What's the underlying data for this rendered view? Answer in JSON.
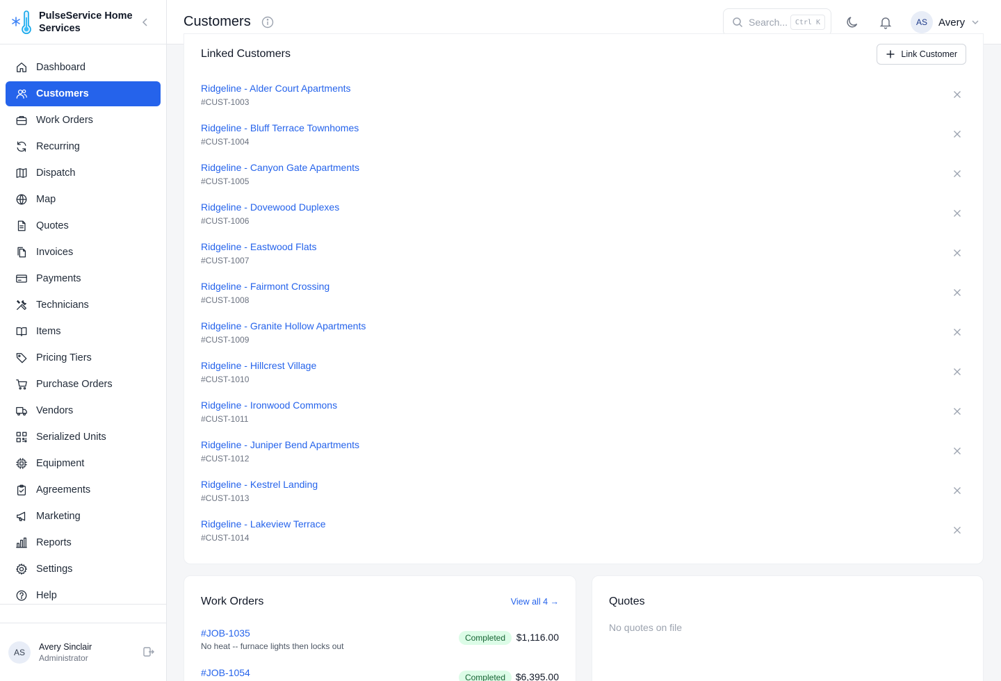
{
  "app": {
    "name": "PulseService Home Services"
  },
  "sidebar": {
    "items": [
      {
        "label": "Dashboard",
        "icon": "home-icon"
      },
      {
        "label": "Customers",
        "icon": "users-icon",
        "active": true
      },
      {
        "label": "Work Orders",
        "icon": "briefcase-icon"
      },
      {
        "label": "Recurring",
        "icon": "refresh-icon"
      },
      {
        "label": "Dispatch",
        "icon": "map-fold-icon"
      },
      {
        "label": "Map",
        "icon": "globe-icon"
      },
      {
        "label": "Quotes",
        "icon": "document-icon"
      },
      {
        "label": "Invoices",
        "icon": "files-icon"
      },
      {
        "label": "Payments",
        "icon": "credit-card-icon"
      },
      {
        "label": "Technicians",
        "icon": "tools-icon"
      },
      {
        "label": "Items",
        "icon": "book-icon"
      },
      {
        "label": "Pricing Tiers",
        "icon": "tag-icon"
      },
      {
        "label": "Purchase Orders",
        "icon": "cart-icon"
      },
      {
        "label": "Vendors",
        "icon": "truck-icon"
      },
      {
        "label": "Serialized Units",
        "icon": "qr-icon"
      },
      {
        "label": "Equipment",
        "icon": "chip-icon"
      },
      {
        "label": "Agreements",
        "icon": "clipboard-icon"
      },
      {
        "label": "Marketing",
        "icon": "megaphone-icon"
      },
      {
        "label": "Reports",
        "icon": "bar-chart-icon"
      },
      {
        "label": "Settings",
        "icon": "gear-icon"
      },
      {
        "label": "Help",
        "icon": "help-icon"
      }
    ],
    "user": {
      "initials": "AS",
      "name": "Avery Sinclair",
      "role": "Administrator"
    }
  },
  "header": {
    "title": "Customers",
    "search_placeholder": "Search...",
    "search_shortcut": "Ctrl K",
    "account": {
      "initials": "AS",
      "name": "Avery"
    }
  },
  "linked_customers": {
    "title": "Linked Customers",
    "link_button": "Link Customer",
    "items": [
      {
        "name": "Ridgeline - Alder Court Apartments",
        "id": "#CUST-1003"
      },
      {
        "name": "Ridgeline - Bluff Terrace Townhomes",
        "id": "#CUST-1004"
      },
      {
        "name": "Ridgeline - Canyon Gate Apartments",
        "id": "#CUST-1005"
      },
      {
        "name": "Ridgeline - Dovewood Duplexes",
        "id": "#CUST-1006"
      },
      {
        "name": "Ridgeline - Eastwood Flats",
        "id": "#CUST-1007"
      },
      {
        "name": "Ridgeline - Fairmont Crossing",
        "id": "#CUST-1008"
      },
      {
        "name": "Ridgeline - Granite Hollow Apartments",
        "id": "#CUST-1009"
      },
      {
        "name": "Ridgeline - Hillcrest Village",
        "id": "#CUST-1010"
      },
      {
        "name": "Ridgeline - Ironwood Commons",
        "id": "#CUST-1011"
      },
      {
        "name": "Ridgeline - Juniper Bend Apartments",
        "id": "#CUST-1012"
      },
      {
        "name": "Ridgeline - Kestrel Landing",
        "id": "#CUST-1013"
      },
      {
        "name": "Ridgeline - Lakeview Terrace",
        "id": "#CUST-1014"
      }
    ]
  },
  "work_orders": {
    "title": "Work Orders",
    "view_all": "View all 4 →",
    "items": [
      {
        "id": "#JOB-1035",
        "desc": "No heat -- furnace lights then locks out",
        "status": "Completed",
        "amount": "$1,116.00"
      },
      {
        "id": "#JOB-1054",
        "desc": "",
        "status": "Completed",
        "amount": "$6,395.00"
      }
    ]
  },
  "quotes": {
    "title": "Quotes",
    "empty": "No quotes on file"
  },
  "colors": {
    "accent": "#2563eb",
    "status_completed_bg": "#dcfce7",
    "status_completed_fg": "#166534"
  }
}
